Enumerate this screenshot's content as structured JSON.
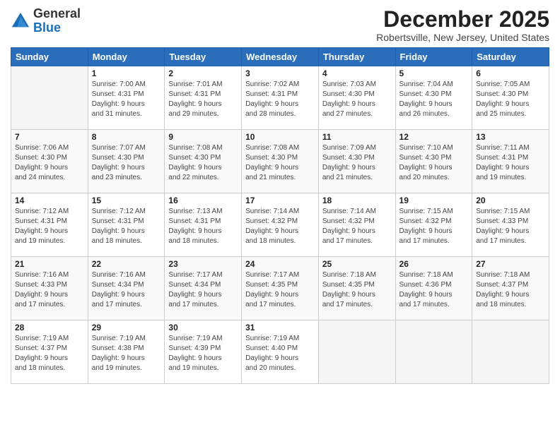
{
  "header": {
    "logo_general": "General",
    "logo_blue": "Blue",
    "month_title": "December 2025",
    "subtitle": "Robertsville, New Jersey, United States"
  },
  "days_of_week": [
    "Sunday",
    "Monday",
    "Tuesday",
    "Wednesday",
    "Thursday",
    "Friday",
    "Saturday"
  ],
  "weeks": [
    [
      {
        "day": "",
        "info": ""
      },
      {
        "day": "1",
        "info": "Sunrise: 7:00 AM\nSunset: 4:31 PM\nDaylight: 9 hours\nand 31 minutes."
      },
      {
        "day": "2",
        "info": "Sunrise: 7:01 AM\nSunset: 4:31 PM\nDaylight: 9 hours\nand 29 minutes."
      },
      {
        "day": "3",
        "info": "Sunrise: 7:02 AM\nSunset: 4:31 PM\nDaylight: 9 hours\nand 28 minutes."
      },
      {
        "day": "4",
        "info": "Sunrise: 7:03 AM\nSunset: 4:30 PM\nDaylight: 9 hours\nand 27 minutes."
      },
      {
        "day": "5",
        "info": "Sunrise: 7:04 AM\nSunset: 4:30 PM\nDaylight: 9 hours\nand 26 minutes."
      },
      {
        "day": "6",
        "info": "Sunrise: 7:05 AM\nSunset: 4:30 PM\nDaylight: 9 hours\nand 25 minutes."
      }
    ],
    [
      {
        "day": "7",
        "info": "Sunrise: 7:06 AM\nSunset: 4:30 PM\nDaylight: 9 hours\nand 24 minutes."
      },
      {
        "day": "8",
        "info": "Sunrise: 7:07 AM\nSunset: 4:30 PM\nDaylight: 9 hours\nand 23 minutes."
      },
      {
        "day": "9",
        "info": "Sunrise: 7:08 AM\nSunset: 4:30 PM\nDaylight: 9 hours\nand 22 minutes."
      },
      {
        "day": "10",
        "info": "Sunrise: 7:08 AM\nSunset: 4:30 PM\nDaylight: 9 hours\nand 21 minutes."
      },
      {
        "day": "11",
        "info": "Sunrise: 7:09 AM\nSunset: 4:30 PM\nDaylight: 9 hours\nand 21 minutes."
      },
      {
        "day": "12",
        "info": "Sunrise: 7:10 AM\nSunset: 4:30 PM\nDaylight: 9 hours\nand 20 minutes."
      },
      {
        "day": "13",
        "info": "Sunrise: 7:11 AM\nSunset: 4:31 PM\nDaylight: 9 hours\nand 19 minutes."
      }
    ],
    [
      {
        "day": "14",
        "info": "Sunrise: 7:12 AM\nSunset: 4:31 PM\nDaylight: 9 hours\nand 19 minutes."
      },
      {
        "day": "15",
        "info": "Sunrise: 7:12 AM\nSunset: 4:31 PM\nDaylight: 9 hours\nand 18 minutes."
      },
      {
        "day": "16",
        "info": "Sunrise: 7:13 AM\nSunset: 4:31 PM\nDaylight: 9 hours\nand 18 minutes."
      },
      {
        "day": "17",
        "info": "Sunrise: 7:14 AM\nSunset: 4:32 PM\nDaylight: 9 hours\nand 18 minutes."
      },
      {
        "day": "18",
        "info": "Sunrise: 7:14 AM\nSunset: 4:32 PM\nDaylight: 9 hours\nand 17 minutes."
      },
      {
        "day": "19",
        "info": "Sunrise: 7:15 AM\nSunset: 4:32 PM\nDaylight: 9 hours\nand 17 minutes."
      },
      {
        "day": "20",
        "info": "Sunrise: 7:15 AM\nSunset: 4:33 PM\nDaylight: 9 hours\nand 17 minutes."
      }
    ],
    [
      {
        "day": "21",
        "info": "Sunrise: 7:16 AM\nSunset: 4:33 PM\nDaylight: 9 hours\nand 17 minutes."
      },
      {
        "day": "22",
        "info": "Sunrise: 7:16 AM\nSunset: 4:34 PM\nDaylight: 9 hours\nand 17 minutes."
      },
      {
        "day": "23",
        "info": "Sunrise: 7:17 AM\nSunset: 4:34 PM\nDaylight: 9 hours\nand 17 minutes."
      },
      {
        "day": "24",
        "info": "Sunrise: 7:17 AM\nSunset: 4:35 PM\nDaylight: 9 hours\nand 17 minutes."
      },
      {
        "day": "25",
        "info": "Sunrise: 7:18 AM\nSunset: 4:35 PM\nDaylight: 9 hours\nand 17 minutes."
      },
      {
        "day": "26",
        "info": "Sunrise: 7:18 AM\nSunset: 4:36 PM\nDaylight: 9 hours\nand 17 minutes."
      },
      {
        "day": "27",
        "info": "Sunrise: 7:18 AM\nSunset: 4:37 PM\nDaylight: 9 hours\nand 18 minutes."
      }
    ],
    [
      {
        "day": "28",
        "info": "Sunrise: 7:19 AM\nSunset: 4:37 PM\nDaylight: 9 hours\nand 18 minutes."
      },
      {
        "day": "29",
        "info": "Sunrise: 7:19 AM\nSunset: 4:38 PM\nDaylight: 9 hours\nand 19 minutes."
      },
      {
        "day": "30",
        "info": "Sunrise: 7:19 AM\nSunset: 4:39 PM\nDaylight: 9 hours\nand 19 minutes."
      },
      {
        "day": "31",
        "info": "Sunrise: 7:19 AM\nSunset: 4:40 PM\nDaylight: 9 hours\nand 20 minutes."
      },
      {
        "day": "",
        "info": ""
      },
      {
        "day": "",
        "info": ""
      },
      {
        "day": "",
        "info": ""
      }
    ]
  ]
}
